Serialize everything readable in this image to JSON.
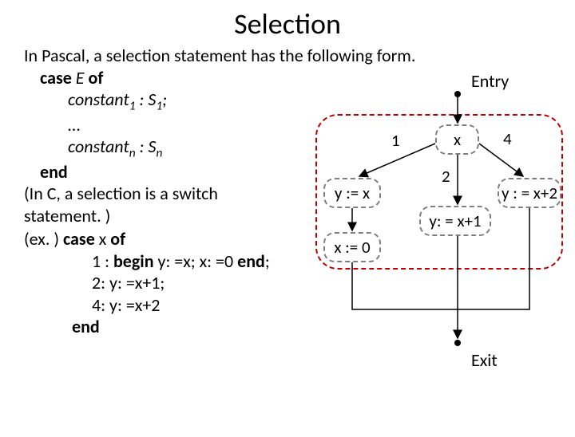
{
  "title": "Selection",
  "intro": "In Pascal, a selection statement has the following form.",
  "case_kw": "case",
  "of_kw": "of",
  "E": "E",
  "const1_line_a": "constant",
  "const1_sub": "1",
  "const1_line_b": " : S",
  "const1_sub2": "1",
  "const1_semi": ";",
  "ellipsis": "…",
  "constn_line_a": "constant",
  "constn_sub": "n",
  "constn_line_b": " : S",
  "constn_sub2": "n",
  "end_kw": "end",
  "note1": "(In C, a selection is a switch",
  "note2": "statement. )",
  "ex_head_a": "(ex. ) ",
  "ex_case": "case",
  "ex_xof": " x ",
  "ex_of": "of",
  "ex_l1a": "1 : ",
  "ex_l1b": "begin",
  "ex_l1c": " y: =x; x: =0 ",
  "ex_l1d": "end",
  "ex_l1e": ";",
  "ex_l2": "2:  y: =x+1;",
  "ex_l4": "4:  y: =x+2",
  "ex_end": "end",
  "entry": "Entry",
  "exit": "Exit",
  "node_x": "x",
  "node_yx": "y := x",
  "node_x0": "x := 0",
  "node_yx1": "y: = x+1",
  "node_yx2": "y : = x+2",
  "edge1": "1",
  "edge2": "2",
  "edge4": "4"
}
